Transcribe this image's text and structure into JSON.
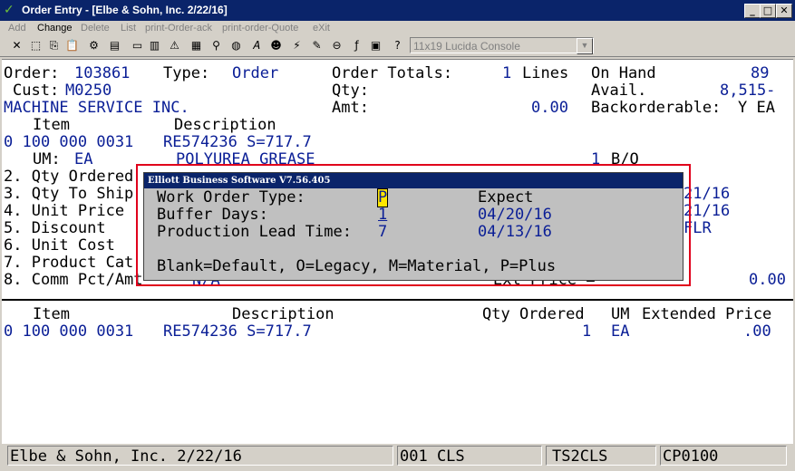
{
  "window": {
    "title": "Order Entry - [Elbe & Sohn, Inc. 2/22/16]"
  },
  "menu": [
    "Add",
    "Change",
    "Delete",
    "List",
    "print-Order-ack",
    "print-order-Quote",
    "eXit"
  ],
  "toolbar": {
    "font": "11x19 Lucida Console"
  },
  "order": {
    "order_label": "Order:",
    "order_no": "103861",
    "type_label": "Type:",
    "type_value": "Order",
    "totals_label": "Order Totals:",
    "lines_count": "1",
    "lines_label": "Lines",
    "onhand_label": "On Hand",
    "onhand_value": "89",
    "cust_label": "Cust:",
    "cust_no": "M0250",
    "qty_label": "Qty:",
    "avail_label": "Avail.",
    "avail_value": "8,515-",
    "cust_name": "MACHINE SERVICE INC.",
    "amt_label": "Amt:",
    "amt_value": "0.00",
    "backorder_label": "Backorderable:",
    "backorder_value": "Y EA",
    "item_header": "Item",
    "desc_header": "Description",
    "line_no": "0 100 000 0031",
    "line_desc": "RE574236 S=717.7",
    "um_label": "UM:",
    "um_value": "EA",
    "line_desc2": "POLYUREA GREASE",
    "bo_count": "1",
    "bo_label": "B/O",
    "fields": [
      "2. Qty Ordered",
      "3. Qty To Ship",
      "4. Unit Price",
      "5. Discount",
      "6. Unit Cost",
      "7. Product Cat",
      "8. Comm Pct/Amt"
    ],
    "right_partial": [
      "21/16",
      "21/16",
      "FLR"
    ],
    "comm_value": "N/A",
    "ext_price_label": "Ext Price =",
    "ext_price_value": "0.00"
  },
  "lines_table": {
    "headers": {
      "item": "Item",
      "description": "Description",
      "qty": "Qty Ordered",
      "um": "UM",
      "ext": "Extended Price"
    },
    "rows": [
      {
        "item": "0 100 000 0031",
        "description": "RE574236 S=717.7",
        "qty": "1",
        "um": "EA",
        "ext": ".00"
      }
    ]
  },
  "dialog": {
    "title": "Elliott Business Software V7.56.405",
    "wo_type_label": "Work Order Type:",
    "wo_type_value": "P",
    "expect_label": "Expect",
    "buffer_label": "Buffer Days:",
    "buffer_value": "1",
    "buffer_date": "04/20/16",
    "lead_label": "Production Lead Time:",
    "lead_value": "7",
    "lead_date": "04/13/16",
    "hint": "Blank=Default, O=Legacy, M=Material, P=Plus"
  },
  "status": {
    "company": "Elbe & Sohn, Inc. 2/22/16",
    "session": "001 CLS",
    "terminal": "TS2CLS",
    "printer": "CP0100"
  },
  "colors": {
    "title_bar": "#0a246a",
    "field_text": "#0a1e96",
    "highlight": "#ffe600",
    "frame": "#e0001b"
  }
}
